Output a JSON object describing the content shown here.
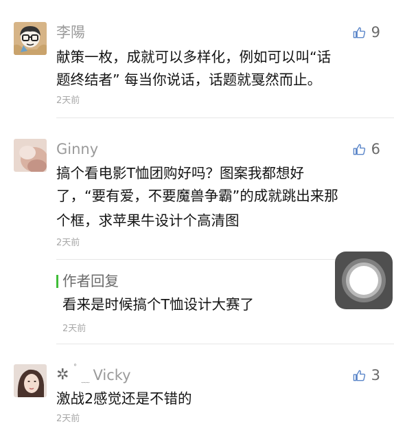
{
  "comments": [
    {
      "username": "李陽",
      "likes": "9",
      "lines": [
        "献策一枚，成就可以多样化，例如可以叫“话",
        "题终结者” 每当你说话，话题就戛然而止。"
      ],
      "time": "2天前"
    },
    {
      "username": "Ginny",
      "likes": "6",
      "lines": [
        "搞个看电影T恤团购好吗？图案我都想好",
        "了，“要有爱，不要魔兽争霸”的成就跳出来那",
        "个框，求苹果牛设计个高清图"
      ],
      "time": "2天前",
      "reply": {
        "label": "作者回复",
        "text": "看来是时候搞个T恤设计大赛了",
        "time": "2天前"
      }
    },
    {
      "username_prefix": "✲",
      "username_sup": "˚",
      "username_wave": "﹏",
      "username": "Vicky",
      "likes": "3",
      "lines": [
        "激战2感觉还是不错的"
      ],
      "time": "2天前"
    }
  ],
  "colors": {
    "username": "#9a9a9a",
    "body": "#141414",
    "time": "#a8a8a8",
    "like_icon": "#5b86c9",
    "reply_bar": "#3fbd38"
  }
}
